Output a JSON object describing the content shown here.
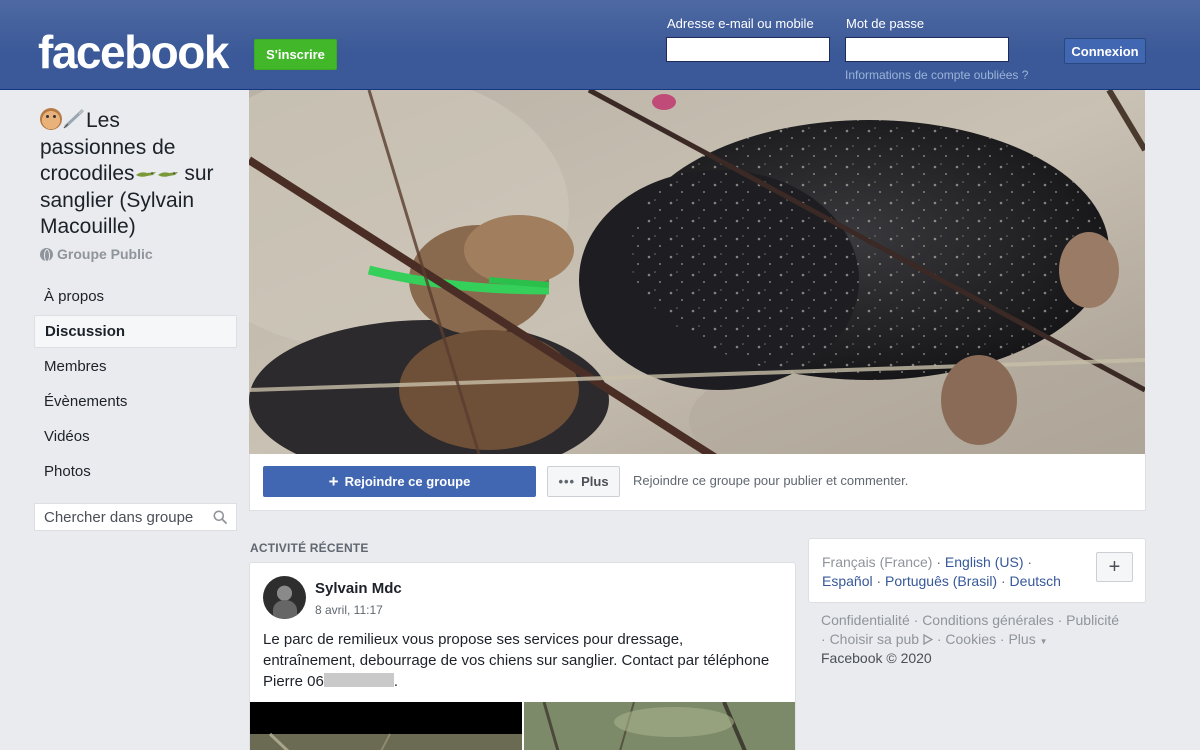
{
  "header": {
    "logo": "facebook",
    "signup_label": "S'inscrire",
    "email_label": "Adresse e-mail ou mobile",
    "password_label": "Mot de passe",
    "login_label": "Connexion",
    "forgot_label": "Informations de compte oubliées ?"
  },
  "group": {
    "title_line1": "Les",
    "title_line2": "passionnes de",
    "title_line3a": "crocodiles",
    "title_line3b": " sur",
    "title_line4": "sanglier (Sylvain",
    "title_line5": "Macouille)",
    "privacy": "Groupe Public"
  },
  "nav": {
    "items": [
      {
        "label": "À propos"
      },
      {
        "label": "Discussion"
      },
      {
        "label": "Membres"
      },
      {
        "label": "Évènements"
      },
      {
        "label": "Vidéos"
      },
      {
        "label": "Photos"
      }
    ],
    "search_placeholder": "Chercher dans groupe"
  },
  "cover_actions": {
    "join_label": "Rejoindre ce groupe",
    "more_label": "Plus",
    "hint": "Rejoindre ce groupe pour publier et commenter."
  },
  "activity": {
    "section_title": "ACTIVITÉ RÉCENTE",
    "post": {
      "author": "Sylvain Mdc",
      "time": "8 avril, 11:17",
      "text_line1": "Le parc de remilieux vous propose ses services pour dressage,",
      "text_line2": "entraînement, debourrage de vos chiens sur sanglier. Contact par téléphone",
      "text_line3_start": "Pierre 06",
      "text_line3_end": "."
    }
  },
  "languages": {
    "current": "Français (France)",
    "links": [
      "English (US)",
      "Español",
      "Português (Brasil)",
      "Deutsch"
    ],
    "sep": " · "
  },
  "footer": {
    "links": [
      "Confidentialité",
      "Conditions générales",
      "Publicité",
      "Choisir sa pub",
      "Cookies",
      "Plus"
    ],
    "copyright": "Facebook © 2020"
  },
  "colors": {
    "brand_blue": "#3b5998",
    "signup_green": "#42b72a",
    "button_blue": "#4267b2",
    "page_bg": "#e9ebee"
  },
  "icons": [
    "globe-icon",
    "search-icon",
    "plus-icon",
    "more-dots-icon",
    "adchoices-icon",
    "hamster-emoji",
    "syringe-emoji",
    "crocodile-emoji"
  ]
}
